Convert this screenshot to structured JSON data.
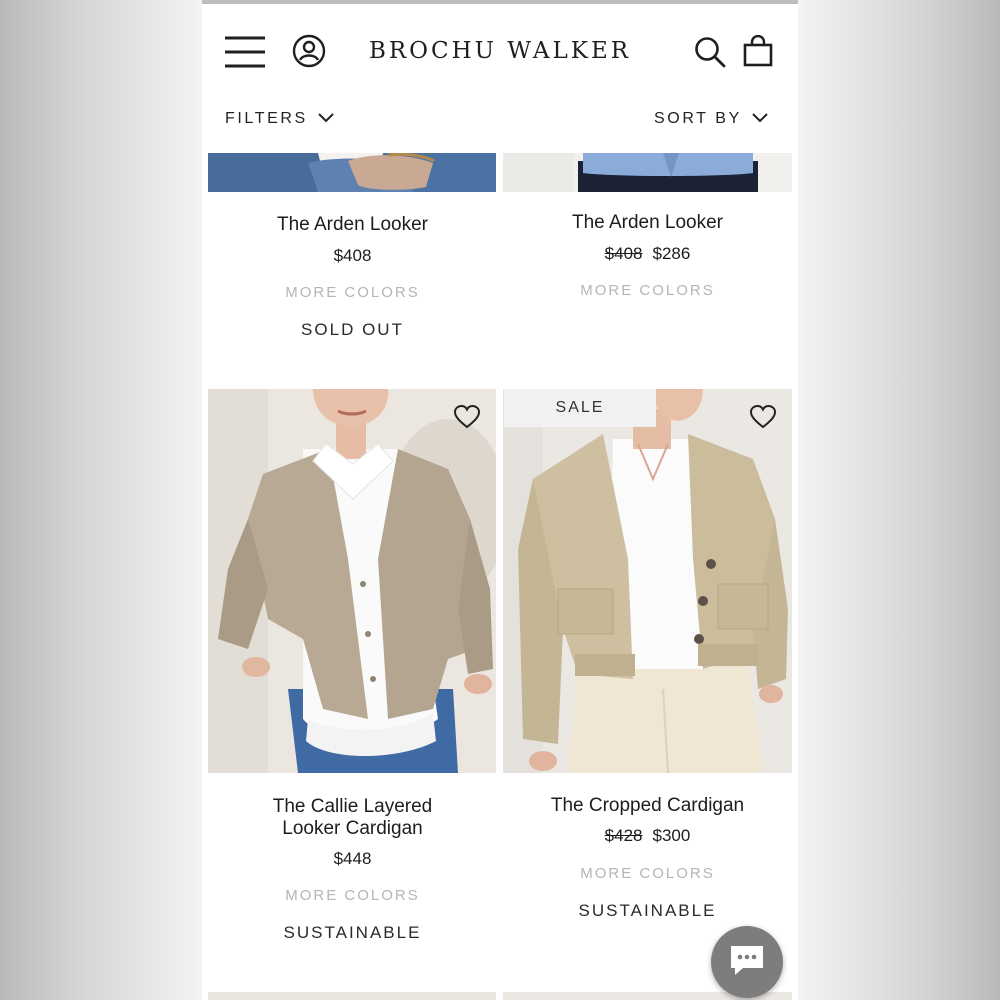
{
  "header": {
    "brand": "BROCHU WALKER",
    "menu_icon": "hamburger-menu-icon",
    "account_icon": "user-account-icon",
    "search_icon": "search-icon",
    "bag_icon": "shopping-bag-icon"
  },
  "toolbar": {
    "filters_label": "FILTERS",
    "sort_label": "SORT BY",
    "chevron_icon": "chevron-down-icon"
  },
  "products": [
    {
      "title": "The Arden Looker",
      "price": "$408",
      "more_colors": "MORE COLORS",
      "status": "SOLD OUT"
    },
    {
      "title": "The Arden Looker",
      "price_original": "$408",
      "price_sale": "$286",
      "more_colors": "MORE COLORS"
    },
    {
      "title_line1": "The Callie Layered",
      "title_line2": "Looker Cardigan",
      "price": "$448",
      "more_colors": "MORE COLORS",
      "tag": "SUSTAINABLE",
      "wishlist_icon": "heart-icon"
    },
    {
      "title": "The Cropped Cardigan",
      "price_original": "$428",
      "price_sale": "$300",
      "more_colors": "MORE COLORS",
      "tag": "SUSTAINABLE",
      "badge": "SALE",
      "wishlist_icon": "heart-icon"
    }
  ],
  "chat": {
    "icon": "chat-bubble-icon"
  },
  "colors": {
    "text": "#1d1d1d",
    "muted": "#b5b5b5",
    "sale_badge_bg": "#f1f1f1",
    "chat_bg": "#7d7d7d"
  }
}
